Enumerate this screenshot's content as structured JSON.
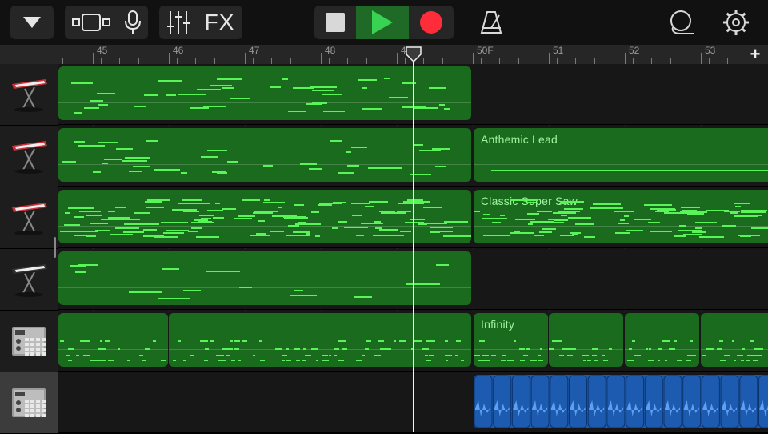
{
  "toolbar": {
    "fx_label": "FX",
    "record_color": "#ff2d3a",
    "play_color": "#39d353",
    "play_bg": "#1f6a26"
  },
  "ruler": {
    "bars": [
      "45",
      "46",
      "47",
      "48",
      "49",
      "50F",
      "51",
      "52",
      "53"
    ],
    "add_label": "+"
  },
  "tracks": [
    {
      "instrument": "keyboard-synth",
      "regions": [
        {
          "name": ""
        }
      ]
    },
    {
      "instrument": "keyboard-synth",
      "regions": [
        {
          "name": ""
        },
        {
          "name": "Anthemic Lead"
        }
      ]
    },
    {
      "instrument": "keyboard-synth",
      "regions": [
        {
          "name": ""
        },
        {
          "name": "Classic Super Saw"
        }
      ]
    },
    {
      "instrument": "keyboard-synth",
      "regions": [
        {
          "name": ""
        }
      ]
    },
    {
      "instrument": "drum-machine",
      "regions": [
        {
          "name": ""
        },
        {
          "name": "Infinity"
        }
      ]
    },
    {
      "instrument": "drum-machine",
      "selected": true,
      "regions": [
        {
          "name": ""
        }
      ]
    }
  ],
  "colors": {
    "midi_region": "#1b6b1f",
    "midi_note": "#58f458",
    "audio_region": "#1e5aa8",
    "region_text": "#9ff59f"
  }
}
